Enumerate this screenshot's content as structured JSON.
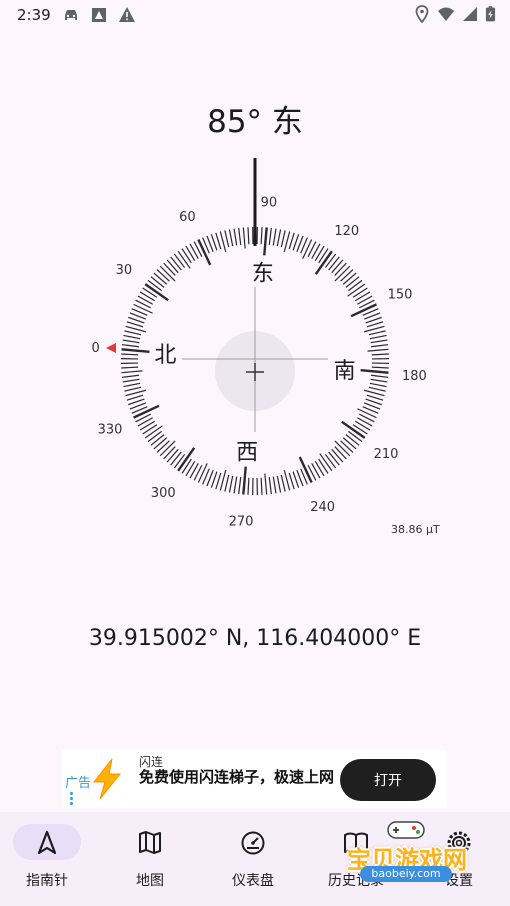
{
  "status_bar": {
    "time": "2:39"
  },
  "heading": "85° 东",
  "compass": {
    "heading_degrees": 85,
    "degree_labels": [
      "0",
      "30",
      "60",
      "90",
      "120",
      "150",
      "180",
      "210",
      "240",
      "270",
      "300",
      "330"
    ],
    "directions": {
      "north": "北",
      "east": "东",
      "south": "南",
      "west": "西"
    },
    "field_strength": "38.86 μT",
    "pointer_color": "#e53935"
  },
  "coordinates": "39.915002° N, 116.404000° E",
  "ad": {
    "tag": "广告",
    "brand": "闪连",
    "description": "免费使用闪连梯子，极速上网",
    "button": "打开"
  },
  "bottom_nav": {
    "items": [
      {
        "label": "指南针",
        "icon": "navigation-arrow-icon",
        "active": true
      },
      {
        "label": "地图",
        "icon": "map-icon",
        "active": false
      },
      {
        "label": "仪表盘",
        "icon": "dashboard-gauge-icon",
        "active": false
      },
      {
        "label": "历史记录",
        "icon": "book-icon",
        "active": false
      },
      {
        "label": "设置",
        "icon": "gear-icon",
        "active": false
      }
    ]
  },
  "watermark": {
    "title": "宝贝游戏网",
    "url": "baobeiy.com"
  },
  "colors": {
    "accent": "#e8def8",
    "background": "#fdf7fd",
    "ad_button": "#1f1f1f"
  }
}
